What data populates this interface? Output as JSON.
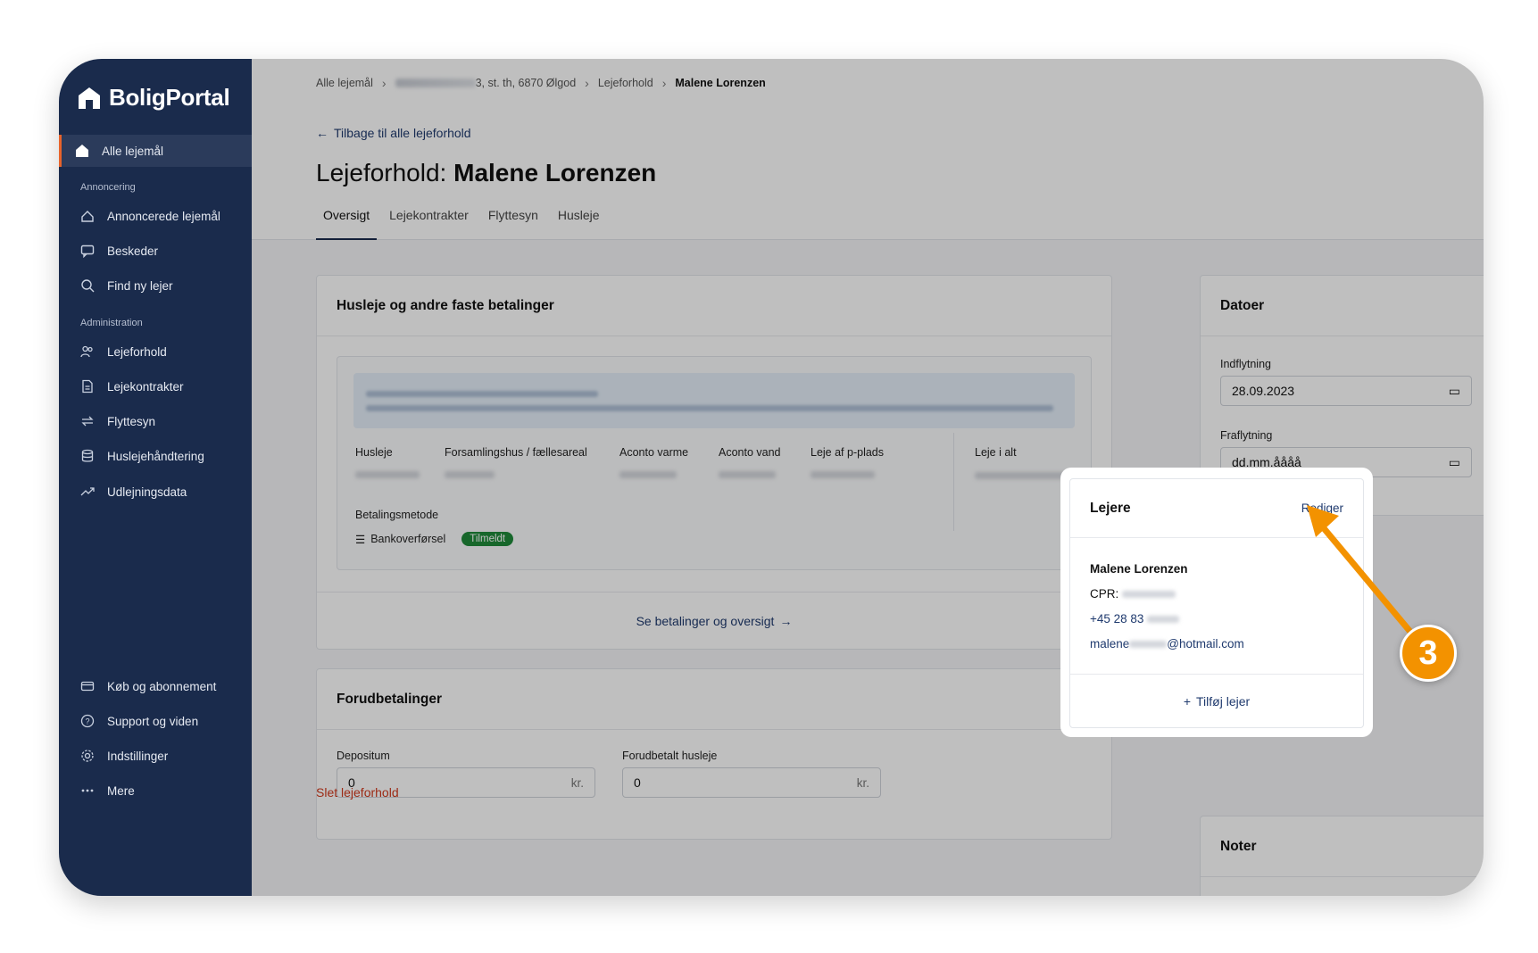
{
  "app": {
    "brand": "BoligPortal"
  },
  "sidebar": {
    "top_item": "Alle lejemål",
    "section_annoncering": "Annoncering",
    "annoncering_items": [
      "Annoncerede lejemål",
      "Beskeder",
      "Find ny lejer"
    ],
    "section_administration": "Administration",
    "administration_items": [
      "Lejeforhold",
      "Lejekontrakter",
      "Flyttesyn",
      "Huslejehåndtering",
      "Udlejningsdata"
    ],
    "bottom_items": [
      "Køb og abonnement",
      "Support og viden",
      "Indstillinger",
      "Mere"
    ]
  },
  "breadcrumb": {
    "root": "Alle lejemål",
    "address_suffix": "3, st. th, 6870 Ølgod",
    "parent": "Lejeforhold",
    "current": "Malene Lorenzen"
  },
  "back_link": "Tilbage til alle lejeforhold",
  "title": {
    "prefix": "Lejeforhold:",
    "name": "Malene Lorenzen"
  },
  "tabs": [
    "Oversigt",
    "Lejekontrakter",
    "Flyttesyn",
    "Husleje"
  ],
  "payments_card": {
    "title": "Husleje og andre faste betalinger",
    "columns": [
      "Husleje",
      "Forsamlingshus / fællesareal",
      "Aconto varme",
      "Aconto vand",
      "Leje af p-plads",
      "Leje i alt"
    ],
    "payment_method_label": "Betalingsmetode",
    "payment_method": "Bankoverførsel",
    "status_badge": "Tilmeldt",
    "footer_link": "Se betalinger og oversigt"
  },
  "prepayments_card": {
    "title": "Forudbetalinger",
    "deposit_label": "Depositum",
    "deposit_value": "0",
    "prepaid_rent_label": "Forudbetalt husleje",
    "prepaid_rent_value": "0",
    "currency_suffix": "kr."
  },
  "delete_link": "Slet lejeforhold",
  "dates_card": {
    "title": "Datoer",
    "move_in_label": "Indflytning",
    "move_in_value": "28.09.2023",
    "move_out_label": "Fraflytning",
    "move_out_placeholder": "dd.mm.åååå"
  },
  "tenants_card": {
    "title": "Lejere",
    "edit_link": "Rediger",
    "tenant_name": "Malene Lorenzen",
    "cpr_label": "CPR:",
    "phone_prefix": "+45 28 83",
    "email_prefix": "malene",
    "email_suffix": "@hotmail.com",
    "add_tenant": "Tilføj lejer"
  },
  "notes_card": {
    "title": "Noter"
  },
  "annotation": {
    "step": "3",
    "color": "#f39200"
  }
}
